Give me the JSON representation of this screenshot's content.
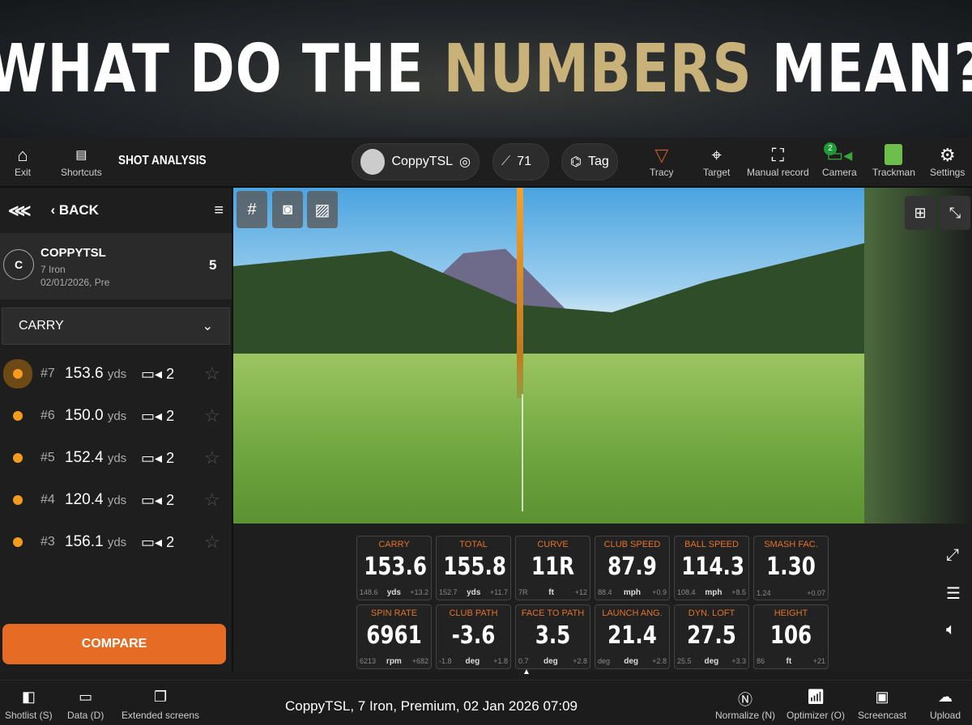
{
  "banner": {
    "pre": "WHAT DO THE ",
    "gold": "NUMBERS",
    "post": " MEAN?"
  },
  "toolbar": {
    "exit": "Exit",
    "shortcuts": "Shortcuts",
    "title": "SHOT ANALYSIS",
    "user": "CoppyTSL",
    "club_count": "71",
    "tag": "Tag",
    "tracy": "Tracy",
    "target": "Target",
    "manual": "Manual record",
    "camera": "Camera",
    "camera_badge": "2",
    "trackman": "Trackman",
    "settings": "Settings"
  },
  "left": {
    "back": "BACK",
    "player_initial": "C",
    "player": "COPPYTSL",
    "club": "7 Iron",
    "session": "02/01/2026, Pre",
    "count": "5",
    "metric": "CARRY",
    "compare": "COMPARE",
    "shots": [
      {
        "n": "#7",
        "d": "153.6",
        "u": "yds",
        "c": "2"
      },
      {
        "n": "#6",
        "d": "150.0",
        "u": "yds",
        "c": "2"
      },
      {
        "n": "#5",
        "d": "152.4",
        "u": "yds",
        "c": "2"
      },
      {
        "n": "#4",
        "d": "120.4",
        "u": "yds",
        "c": "2"
      },
      {
        "n": "#3",
        "d": "156.1",
        "u": "yds",
        "c": "2"
      }
    ]
  },
  "tiles": [
    {
      "label": "CARRY",
      "value": "153.6",
      "min": "148.6",
      "unit": "yds",
      "delta": "+13.2"
    },
    {
      "label": "TOTAL",
      "value": "155.8",
      "min": "152.7",
      "unit": "yds",
      "delta": "+11.7"
    },
    {
      "label": "CURVE",
      "value": "11R",
      "min": "7R",
      "unit": "ft",
      "delta": "+12"
    },
    {
      "label": "CLUB SPEED",
      "value": "87.9",
      "min": "88.4",
      "unit": "mph",
      "delta": "+0.9"
    },
    {
      "label": "BALL SPEED",
      "value": "114.3",
      "min": "108.4",
      "unit": "mph",
      "delta": "+8.5"
    },
    {
      "label": "SMASH FAC.",
      "value": "1.30",
      "min": "1.24",
      "unit": "",
      "delta": "+0.07"
    },
    {
      "label": "SPIN RATE",
      "value": "6961",
      "min": "6213",
      "unit": "rpm",
      "delta": "+682"
    },
    {
      "label": "CLUB PATH",
      "value": "-3.6",
      "min": "-1.8",
      "unit": "deg",
      "delta": "+1.8"
    },
    {
      "label": "FACE TO PATH",
      "value": "3.5",
      "min": "0.7",
      "unit": "deg",
      "delta": "+2.8"
    },
    {
      "label": "LAUNCH ANG.",
      "value": "21.4",
      "min": "deg",
      "unit": "deg",
      "delta": "+2.8"
    },
    {
      "label": "DYN. LOFT",
      "value": "27.5",
      "min": "25.5",
      "unit": "deg",
      "delta": "+3.3"
    },
    {
      "label": "HEIGHT",
      "value": "106",
      "min": "86",
      "unit": "ft",
      "delta": "+21"
    }
  ],
  "bottom": {
    "shotlist": "Shotlist (S)",
    "data": "Data (D)",
    "extended": "Extended screens",
    "status": "CoppyTSL, 7 Iron, Premium, 02 Jan 2026 07:09",
    "normalize": "Normalize (N)",
    "optimizer": "Optimizer (O)",
    "screencast": "Screencast",
    "upload": "Upload"
  }
}
